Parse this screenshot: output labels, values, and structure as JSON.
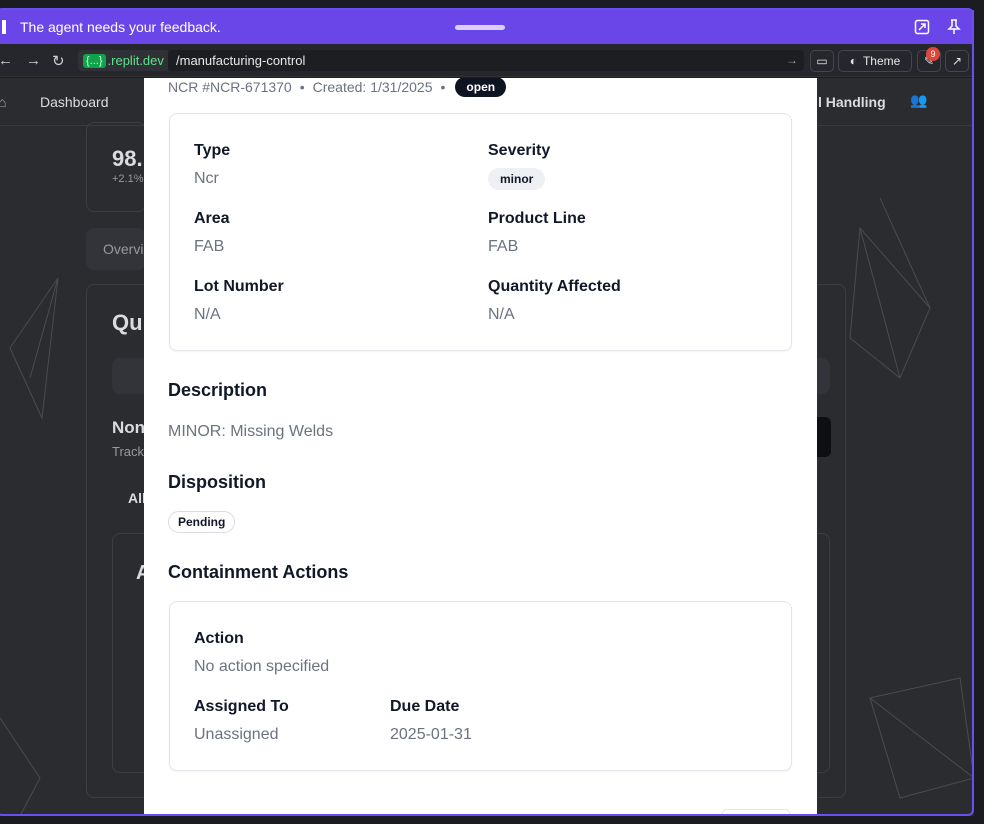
{
  "feedback_bar": {
    "message": "The agent needs your feedback."
  },
  "address_bar": {
    "domain_tag": "{...}",
    "domain": ".replit.dev",
    "path": "/manufacturing-control",
    "theme_label": "Theme",
    "notification_count": "9"
  },
  "background_app": {
    "nav_dashboard": "Dashboard",
    "nav_right": "l Handling",
    "stat_value": "98.",
    "stat_delta": "+2.1%",
    "tab_overview": "Overvi",
    "section_heading": "Qu",
    "subsection_heading": "Non",
    "subsection_sub": "Track",
    "filter_all": "All",
    "card_letter": "A"
  },
  "modal": {
    "ncr_id": "NCR #NCR-671370",
    "created": "Created: 1/31/2025",
    "status": "open",
    "details": {
      "type_label": "Type",
      "type_value": "Ncr",
      "severity_label": "Severity",
      "severity_value": "minor",
      "area_label": "Area",
      "area_value": "FAB",
      "product_line_label": "Product Line",
      "product_line_value": "FAB",
      "lot_label": "Lot Number",
      "lot_value": "N/A",
      "qty_label": "Quantity Affected",
      "qty_value": "N/A"
    },
    "description_title": "Description",
    "description_text": "MINOR: Missing Welds",
    "disposition_title": "Disposition",
    "disposition_value": "Pending",
    "containment_title": "Containment Actions",
    "containment": {
      "action_label": "Action",
      "action_value": "No action specified",
      "assigned_label": "Assigned To",
      "assigned_value": "Unassigned",
      "due_label": "Due Date",
      "due_value": "2025-01-31"
    }
  }
}
